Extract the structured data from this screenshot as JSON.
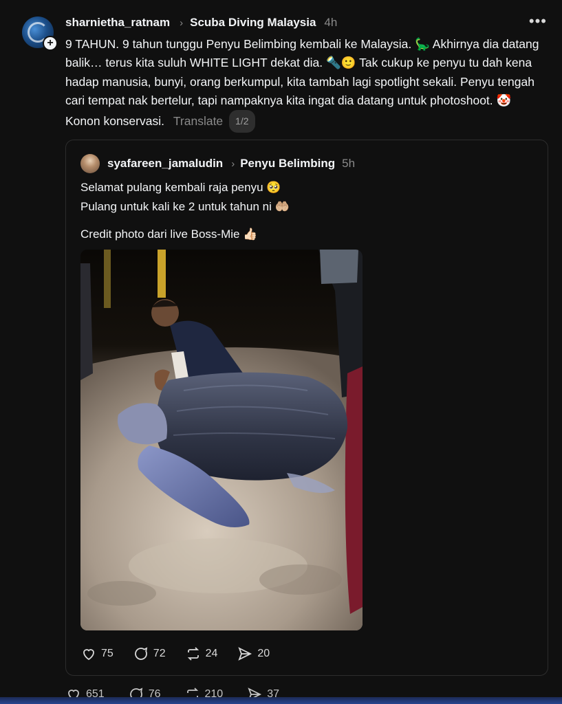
{
  "post": {
    "username": "sharnietha_ratnam",
    "community": "Scuba Diving Malaysia",
    "time": "4h",
    "caption": "9 TAHUN. 9 tahun tunggu Penyu Belimbing kembali ke Malaysia. 🦕 Akhirnya dia datang balik… terus kita suluh WHITE LIGHT dekat dia. 🔦🙂 Tak cukup ke penyu tu dah kena hadap manusia, bunyi, orang berkumpul, kita tambah lagi spotlight sekali. Penyu tengah cari tempat nak bertelur, tapi nampaknya kita ingat dia datang untuk photoshoot. 🤡 Konon konservasi.",
    "translate_label": "Translate",
    "page_badge": "1/2",
    "stats": {
      "likes": "651",
      "comments": "76",
      "reposts": "210",
      "shares": "37"
    }
  },
  "quoted": {
    "username": "syafareen_jamaludin",
    "community": "Penyu Belimbing",
    "time": "5h",
    "line1": "Selamat pulang kembali raja penyu 🥺",
    "line2": "Pulang untuk kali ke 2 untuk tahun ni 🤲🏼",
    "line3": "Credit photo dari live Boss-Mie 👍🏻",
    "stats": {
      "likes": "75",
      "comments": "72",
      "reposts": "24",
      "shares": "20"
    }
  }
}
